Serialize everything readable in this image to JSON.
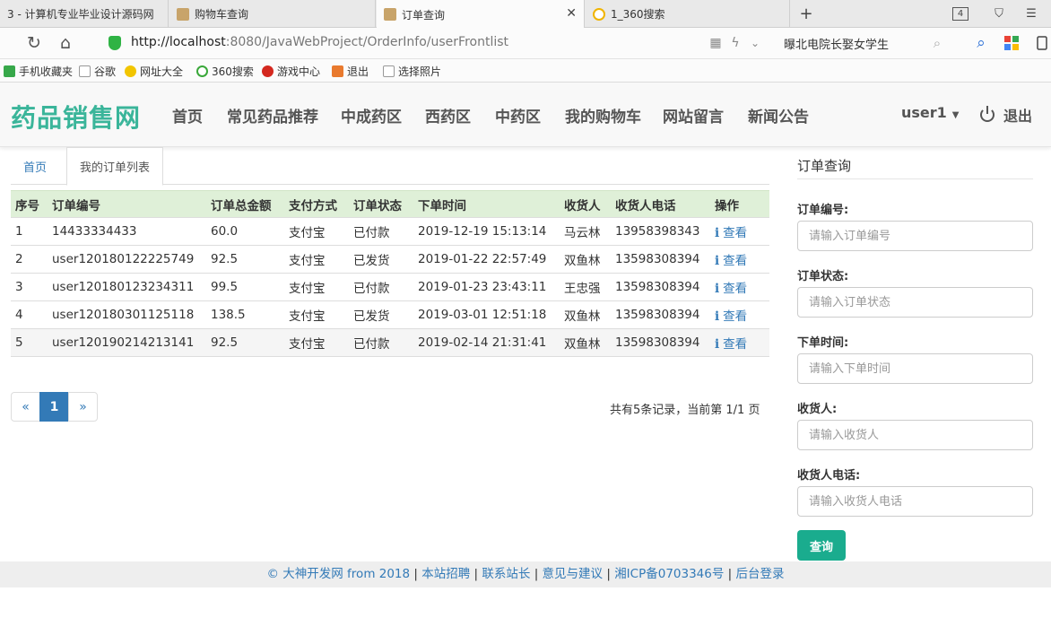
{
  "browser": {
    "tabs": [
      {
        "label": "3 - 计算机专业毕业设计源码网",
        "active": false
      },
      {
        "label": "购物车查询",
        "active": false
      },
      {
        "label": "订单查询",
        "active": true
      },
      {
        "label": "1_360搜索",
        "active": false
      }
    ],
    "new_tab": "+",
    "tab_count": "4",
    "url_host": "http://localhost",
    "url_path": ":8080/JavaWebProject/OrderInfo/userFrontlist",
    "search_text": "曝北电院长娶女学生",
    "bookmarks": [
      "手机收藏夹",
      "谷歌",
      "网址大全",
      "360搜索",
      "游戏中心",
      "退出",
      "选择照片"
    ]
  },
  "site": {
    "brand": "药品销售网",
    "nav": [
      "首页",
      "常见药品推荐",
      "中成药区",
      "西药区",
      "中药区",
      "我的购物车",
      "网站留言",
      "新闻公告"
    ],
    "user": "user1",
    "logout": "退出"
  },
  "crumbs": {
    "home": "首页",
    "current": "我的订单列表"
  },
  "table": {
    "headers": [
      "序号",
      "订单编号",
      "订单总金额",
      "支付方式",
      "订单状态",
      "下单时间",
      "收货人",
      "收货人电话",
      "操作"
    ],
    "action_label": "查看",
    "rows": [
      [
        "1",
        "14433334433",
        "60.0",
        "支付宝",
        "已付款",
        "2019-12-19 15:13:14",
        "马云林",
        "13958398343"
      ],
      [
        "2",
        "user120180122225749",
        "92.5",
        "支付宝",
        "已发货",
        "2019-01-22 22:57:49",
        "双鱼林",
        "13598308394"
      ],
      [
        "3",
        "user120180123234311",
        "99.5",
        "支付宝",
        "已付款",
        "2019-01-23 23:43:11",
        "王忠强",
        "13598308394"
      ],
      [
        "4",
        "user120180301125118",
        "138.5",
        "支付宝",
        "已发货",
        "2019-03-01 12:51:18",
        "双鱼林",
        "13598308394"
      ],
      [
        "5",
        "user120190214213141",
        "92.5",
        "支付宝",
        "已付款",
        "2019-02-14 21:31:41",
        "双鱼林",
        "13598308394"
      ]
    ]
  },
  "pagination": {
    "prev": "«",
    "current": "1",
    "next": "»",
    "info": "共有5条记录，当前第 1/1 页"
  },
  "search_panel": {
    "title": "订单查询",
    "fields": [
      {
        "label": "订单编号:",
        "placeholder": "请输入订单编号"
      },
      {
        "label": "订单状态:",
        "placeholder": "请输入订单状态"
      },
      {
        "label": "下单时间:",
        "placeholder": "请输入下单时间"
      },
      {
        "label": "收货人:",
        "placeholder": "请输入收货人"
      },
      {
        "label": "收货人电话:",
        "placeholder": "请输入收货人电话"
      }
    ],
    "button": "查询"
  },
  "footer": {
    "links": [
      "© 大神开发网 from 2018",
      "本站招聘",
      "联系站长",
      "意见与建议",
      "湘ICP备0703346号",
      "后台登录"
    ],
    "separator": " | "
  },
  "colors": {
    "brand": "#3ab59a",
    "table_header": "#dff0d8",
    "link": "#337ab7",
    "button": "#1aac8e"
  }
}
